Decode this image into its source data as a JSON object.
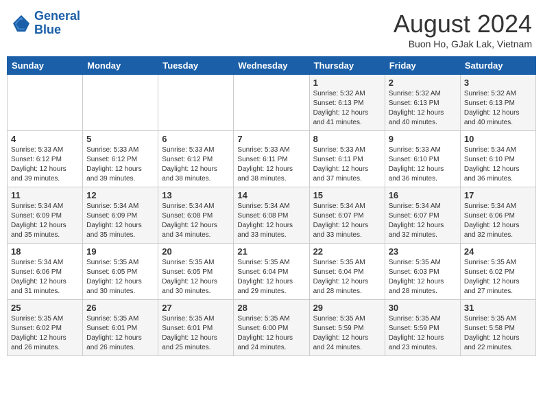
{
  "header": {
    "logo_line1": "General",
    "logo_line2": "Blue",
    "month_title": "August 2024",
    "location": "Buon Ho, GJak Lak, Vietnam"
  },
  "weekdays": [
    "Sunday",
    "Monday",
    "Tuesday",
    "Wednesday",
    "Thursday",
    "Friday",
    "Saturday"
  ],
  "weeks": [
    [
      {
        "day": "",
        "info": ""
      },
      {
        "day": "",
        "info": ""
      },
      {
        "day": "",
        "info": ""
      },
      {
        "day": "",
        "info": ""
      },
      {
        "day": "1",
        "info": "Sunrise: 5:32 AM\nSunset: 6:13 PM\nDaylight: 12 hours\nand 41 minutes."
      },
      {
        "day": "2",
        "info": "Sunrise: 5:32 AM\nSunset: 6:13 PM\nDaylight: 12 hours\nand 40 minutes."
      },
      {
        "day": "3",
        "info": "Sunrise: 5:32 AM\nSunset: 6:13 PM\nDaylight: 12 hours\nand 40 minutes."
      }
    ],
    [
      {
        "day": "4",
        "info": "Sunrise: 5:33 AM\nSunset: 6:12 PM\nDaylight: 12 hours\nand 39 minutes."
      },
      {
        "day": "5",
        "info": "Sunrise: 5:33 AM\nSunset: 6:12 PM\nDaylight: 12 hours\nand 39 minutes."
      },
      {
        "day": "6",
        "info": "Sunrise: 5:33 AM\nSunset: 6:12 PM\nDaylight: 12 hours\nand 38 minutes."
      },
      {
        "day": "7",
        "info": "Sunrise: 5:33 AM\nSunset: 6:11 PM\nDaylight: 12 hours\nand 38 minutes."
      },
      {
        "day": "8",
        "info": "Sunrise: 5:33 AM\nSunset: 6:11 PM\nDaylight: 12 hours\nand 37 minutes."
      },
      {
        "day": "9",
        "info": "Sunrise: 5:33 AM\nSunset: 6:10 PM\nDaylight: 12 hours\nand 36 minutes."
      },
      {
        "day": "10",
        "info": "Sunrise: 5:34 AM\nSunset: 6:10 PM\nDaylight: 12 hours\nand 36 minutes."
      }
    ],
    [
      {
        "day": "11",
        "info": "Sunrise: 5:34 AM\nSunset: 6:09 PM\nDaylight: 12 hours\nand 35 minutes."
      },
      {
        "day": "12",
        "info": "Sunrise: 5:34 AM\nSunset: 6:09 PM\nDaylight: 12 hours\nand 35 minutes."
      },
      {
        "day": "13",
        "info": "Sunrise: 5:34 AM\nSunset: 6:08 PM\nDaylight: 12 hours\nand 34 minutes."
      },
      {
        "day": "14",
        "info": "Sunrise: 5:34 AM\nSunset: 6:08 PM\nDaylight: 12 hours\nand 33 minutes."
      },
      {
        "day": "15",
        "info": "Sunrise: 5:34 AM\nSunset: 6:07 PM\nDaylight: 12 hours\nand 33 minutes."
      },
      {
        "day": "16",
        "info": "Sunrise: 5:34 AM\nSunset: 6:07 PM\nDaylight: 12 hours\nand 32 minutes."
      },
      {
        "day": "17",
        "info": "Sunrise: 5:34 AM\nSunset: 6:06 PM\nDaylight: 12 hours\nand 32 minutes."
      }
    ],
    [
      {
        "day": "18",
        "info": "Sunrise: 5:34 AM\nSunset: 6:06 PM\nDaylight: 12 hours\nand 31 minutes."
      },
      {
        "day": "19",
        "info": "Sunrise: 5:35 AM\nSunset: 6:05 PM\nDaylight: 12 hours\nand 30 minutes."
      },
      {
        "day": "20",
        "info": "Sunrise: 5:35 AM\nSunset: 6:05 PM\nDaylight: 12 hours\nand 30 minutes."
      },
      {
        "day": "21",
        "info": "Sunrise: 5:35 AM\nSunset: 6:04 PM\nDaylight: 12 hours\nand 29 minutes."
      },
      {
        "day": "22",
        "info": "Sunrise: 5:35 AM\nSunset: 6:04 PM\nDaylight: 12 hours\nand 28 minutes."
      },
      {
        "day": "23",
        "info": "Sunrise: 5:35 AM\nSunset: 6:03 PM\nDaylight: 12 hours\nand 28 minutes."
      },
      {
        "day": "24",
        "info": "Sunrise: 5:35 AM\nSunset: 6:02 PM\nDaylight: 12 hours\nand 27 minutes."
      }
    ],
    [
      {
        "day": "25",
        "info": "Sunrise: 5:35 AM\nSunset: 6:02 PM\nDaylight: 12 hours\nand 26 minutes."
      },
      {
        "day": "26",
        "info": "Sunrise: 5:35 AM\nSunset: 6:01 PM\nDaylight: 12 hours\nand 26 minutes."
      },
      {
        "day": "27",
        "info": "Sunrise: 5:35 AM\nSunset: 6:01 PM\nDaylight: 12 hours\nand 25 minutes."
      },
      {
        "day": "28",
        "info": "Sunrise: 5:35 AM\nSunset: 6:00 PM\nDaylight: 12 hours\nand 24 minutes."
      },
      {
        "day": "29",
        "info": "Sunrise: 5:35 AM\nSunset: 5:59 PM\nDaylight: 12 hours\nand 24 minutes."
      },
      {
        "day": "30",
        "info": "Sunrise: 5:35 AM\nSunset: 5:59 PM\nDaylight: 12 hours\nand 23 minutes."
      },
      {
        "day": "31",
        "info": "Sunrise: 5:35 AM\nSunset: 5:58 PM\nDaylight: 12 hours\nand 22 minutes."
      }
    ]
  ]
}
